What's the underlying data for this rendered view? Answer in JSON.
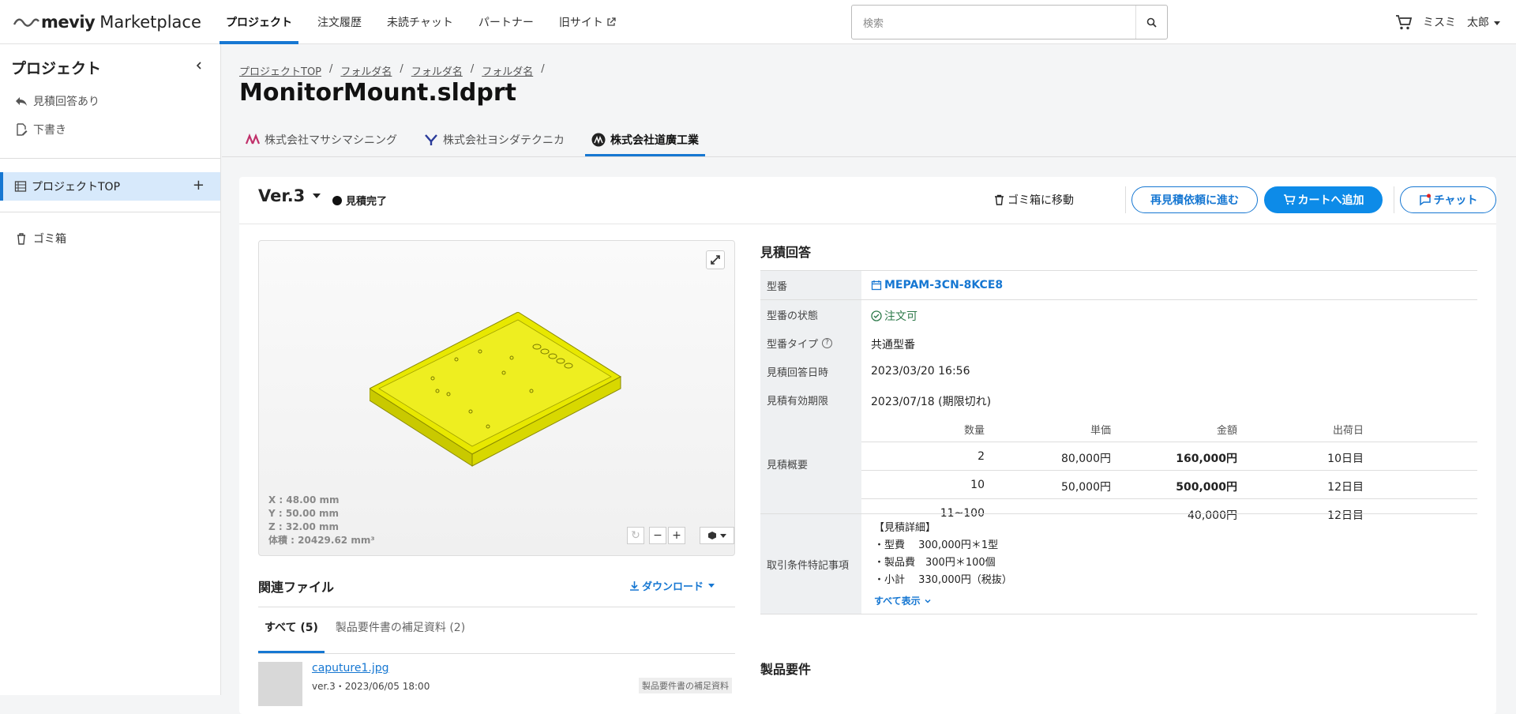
{
  "header": {
    "brand": "meviy",
    "product": "Marketplace",
    "nav": [
      {
        "label": "プロジェクト",
        "active": true
      },
      {
        "label": "注文履歴",
        "active": false
      },
      {
        "label": "未読チャット",
        "active": false
      },
      {
        "label": "パートナー",
        "active": false
      },
      {
        "label": "旧サイト",
        "active": false,
        "external": true
      }
    ],
    "search_placeholder": "検索",
    "user_company": "ミスミ",
    "user_name": "太郎"
  },
  "sidebar": {
    "title": "プロジェクト",
    "links": [
      {
        "label": "見積回答あり",
        "icon": "reply-icon"
      },
      {
        "label": "下書き",
        "icon": "edit-icon"
      }
    ],
    "project_top": "プロジェクトTOP",
    "trash": "ゴミ箱"
  },
  "main": {
    "breadcrumb": [
      "プロジェクトTOP",
      "フォルダ名",
      "フォルダ名",
      "フォルダ名"
    ],
    "title": "MonitorMount.sldprt",
    "tabs": [
      {
        "label": "株式会社マサシマシニング",
        "active": false
      },
      {
        "label": "株式会社ヨシダテクニカ",
        "active": false
      },
      {
        "label": "株式会社道廣工業",
        "active": true
      }
    ]
  },
  "card": {
    "version": "Ver.3",
    "status": "見積完了",
    "trash_link": "ゴミ箱に移動",
    "requote_button": "再見積依頼に進む",
    "cart_button": "カートへ追加",
    "chat_button": "チャット"
  },
  "viewer": {
    "x": "X : 48.00 mm",
    "y": "Y : 50.00 mm",
    "z": "Z : 32.00 mm",
    "volume": "体積 : 20429.62 mm³",
    "model_color": "#e5e500"
  },
  "related": {
    "title": "関連ファイル",
    "download": "ダウンロード",
    "tabs": [
      "すべて (5)",
      "製品要件書の補足資料 (2)"
    ],
    "files": [
      {
        "name": "caputure1.jpg",
        "meta": "ver.3・2023/06/05 18:00",
        "tag": "製品要件書の補足資料"
      }
    ]
  },
  "quote": {
    "title": "見積回答",
    "model_no_label": "型番",
    "model_no": "MEPAM-3CN-8KCE8",
    "model_status_label": "型番の状態",
    "model_status": "注文可",
    "model_type_label": "型番タイプ",
    "model_type": "共通型番",
    "answer_date_label": "見積回答日時",
    "answer_date": "2023/03/20 16:56",
    "expiry_label": "見積有効期限",
    "expiry": "2023/07/18 (期限切れ)",
    "summary_label": "見積概要",
    "summary_headers": [
      "数量",
      "単価",
      "金額",
      "出荷日"
    ],
    "summary_rows": [
      [
        "2",
        "80,000円",
        "160,000円",
        "10日目"
      ],
      [
        "10",
        "50,000円",
        "500,000円",
        "12日目"
      ],
      [
        "11~100",
        "",
        "40,000円",
        "12日目"
      ]
    ],
    "terms_label": "取引条件特記事項",
    "terms": [
      "【見積詳細】",
      "・型費　 300,000円＊1型",
      "・製品費　300円＊100個",
      "・小計　 330,000円（税抜）"
    ],
    "show_all": "すべて表示",
    "requirements_title": "製品要件"
  },
  "colors": {
    "accent": "#1677d2",
    "primary_button": "#0d8be8",
    "ok": "#2d7a4a"
  }
}
